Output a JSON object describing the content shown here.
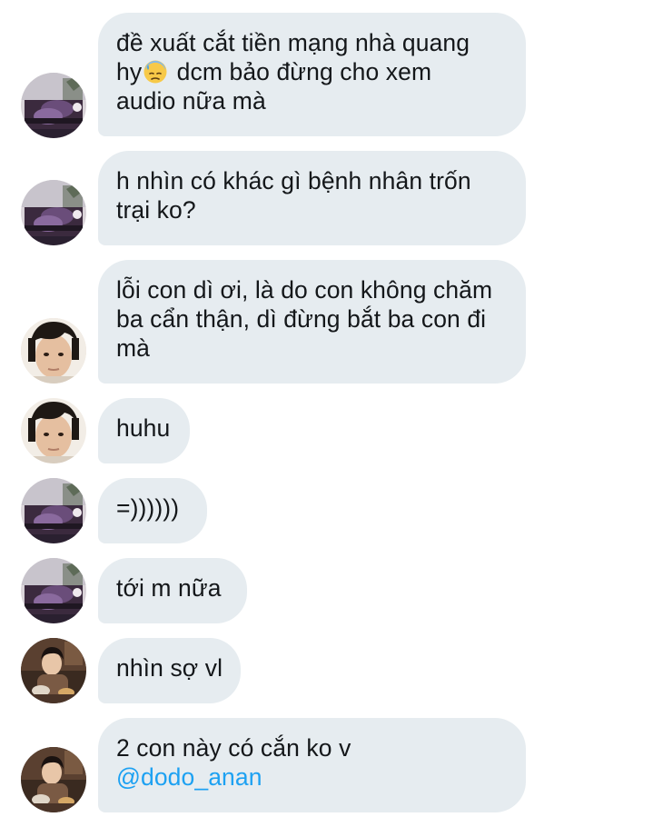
{
  "conversation": {
    "messages": [
      {
        "sender": "user-a",
        "lines": [
          "đề xuất cắt tiền mạng nhà quang",
          "dcm bảo đừng cho xem",
          "audio nữa mà"
        ],
        "line2_prefix": "hy",
        "emoji": "downcast-face-with-sweat-icon"
      },
      {
        "sender": "user-a",
        "lines": [
          "h nhìn có khác gì bệnh nhân trốn",
          "trại ko?"
        ]
      },
      {
        "sender": "user-b",
        "lines": [
          "lỗi con dì ơi, là do con không chăm",
          "ba cẩn thận, dì đừng bắt ba con đi",
          "mà"
        ]
      },
      {
        "sender": "user-b",
        "lines": [
          "huhu"
        ]
      },
      {
        "sender": "user-a",
        "lines": [
          "=))))))"
        ]
      },
      {
        "sender": "user-a",
        "lines": [
          "tới m nữa"
        ]
      },
      {
        "sender": "user-c",
        "lines": [
          "nhìn sợ vl"
        ]
      },
      {
        "sender": "user-c",
        "lines": [
          "2 con này có cắn ko v"
        ],
        "mention": "@dodo_anan"
      }
    ]
  },
  "colors": {
    "bubble_background": "#e6ecf0",
    "text": "#14171a",
    "mention": "#1da1f2",
    "page_background": "#ffffff"
  }
}
